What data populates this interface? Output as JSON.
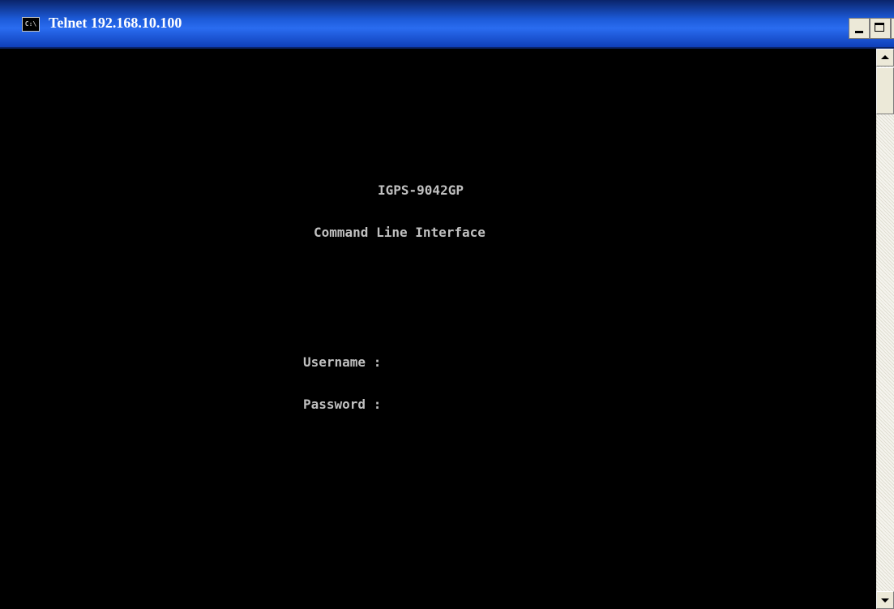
{
  "window": {
    "title": "Telnet 192.168.10.100",
    "icon_name": "console-icon",
    "icon_label": "C:\\"
  },
  "console": {
    "lines": [
      "IGPS-9042GP",
      "Command Line Interface",
      "Username :",
      "Password :"
    ],
    "text_color": "#c0c0c0",
    "background_color": "#000000"
  },
  "controls": {
    "minimize": "minimize-icon",
    "maximize": "maximize-icon",
    "close": "close-icon"
  }
}
